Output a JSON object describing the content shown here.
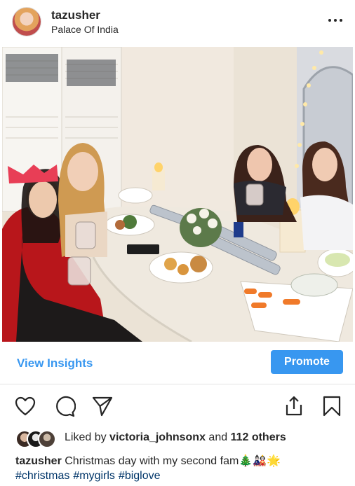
{
  "post": {
    "username": "tazusher",
    "location": "Palace Of India"
  },
  "insights": {
    "view_label": "View Insights",
    "promote_label": "Promote"
  },
  "likes": {
    "prefix": "Liked by ",
    "user": "victoria_johnsonx",
    "middle": " and ",
    "others": "112 others"
  },
  "caption": {
    "user": "tazusher",
    "text": " Christmas day with my second fam🎄🎎🌟",
    "hashtags": [
      "#christmas",
      "#mygirls",
      "#biglove"
    ]
  },
  "colors": {
    "accent": "#3897f0",
    "hashtag": "#003569",
    "text": "#262626"
  },
  "icons": [
    "more-options-icon",
    "heart-icon",
    "comment-icon",
    "send-icon",
    "share-icon",
    "bookmark-icon"
  ]
}
